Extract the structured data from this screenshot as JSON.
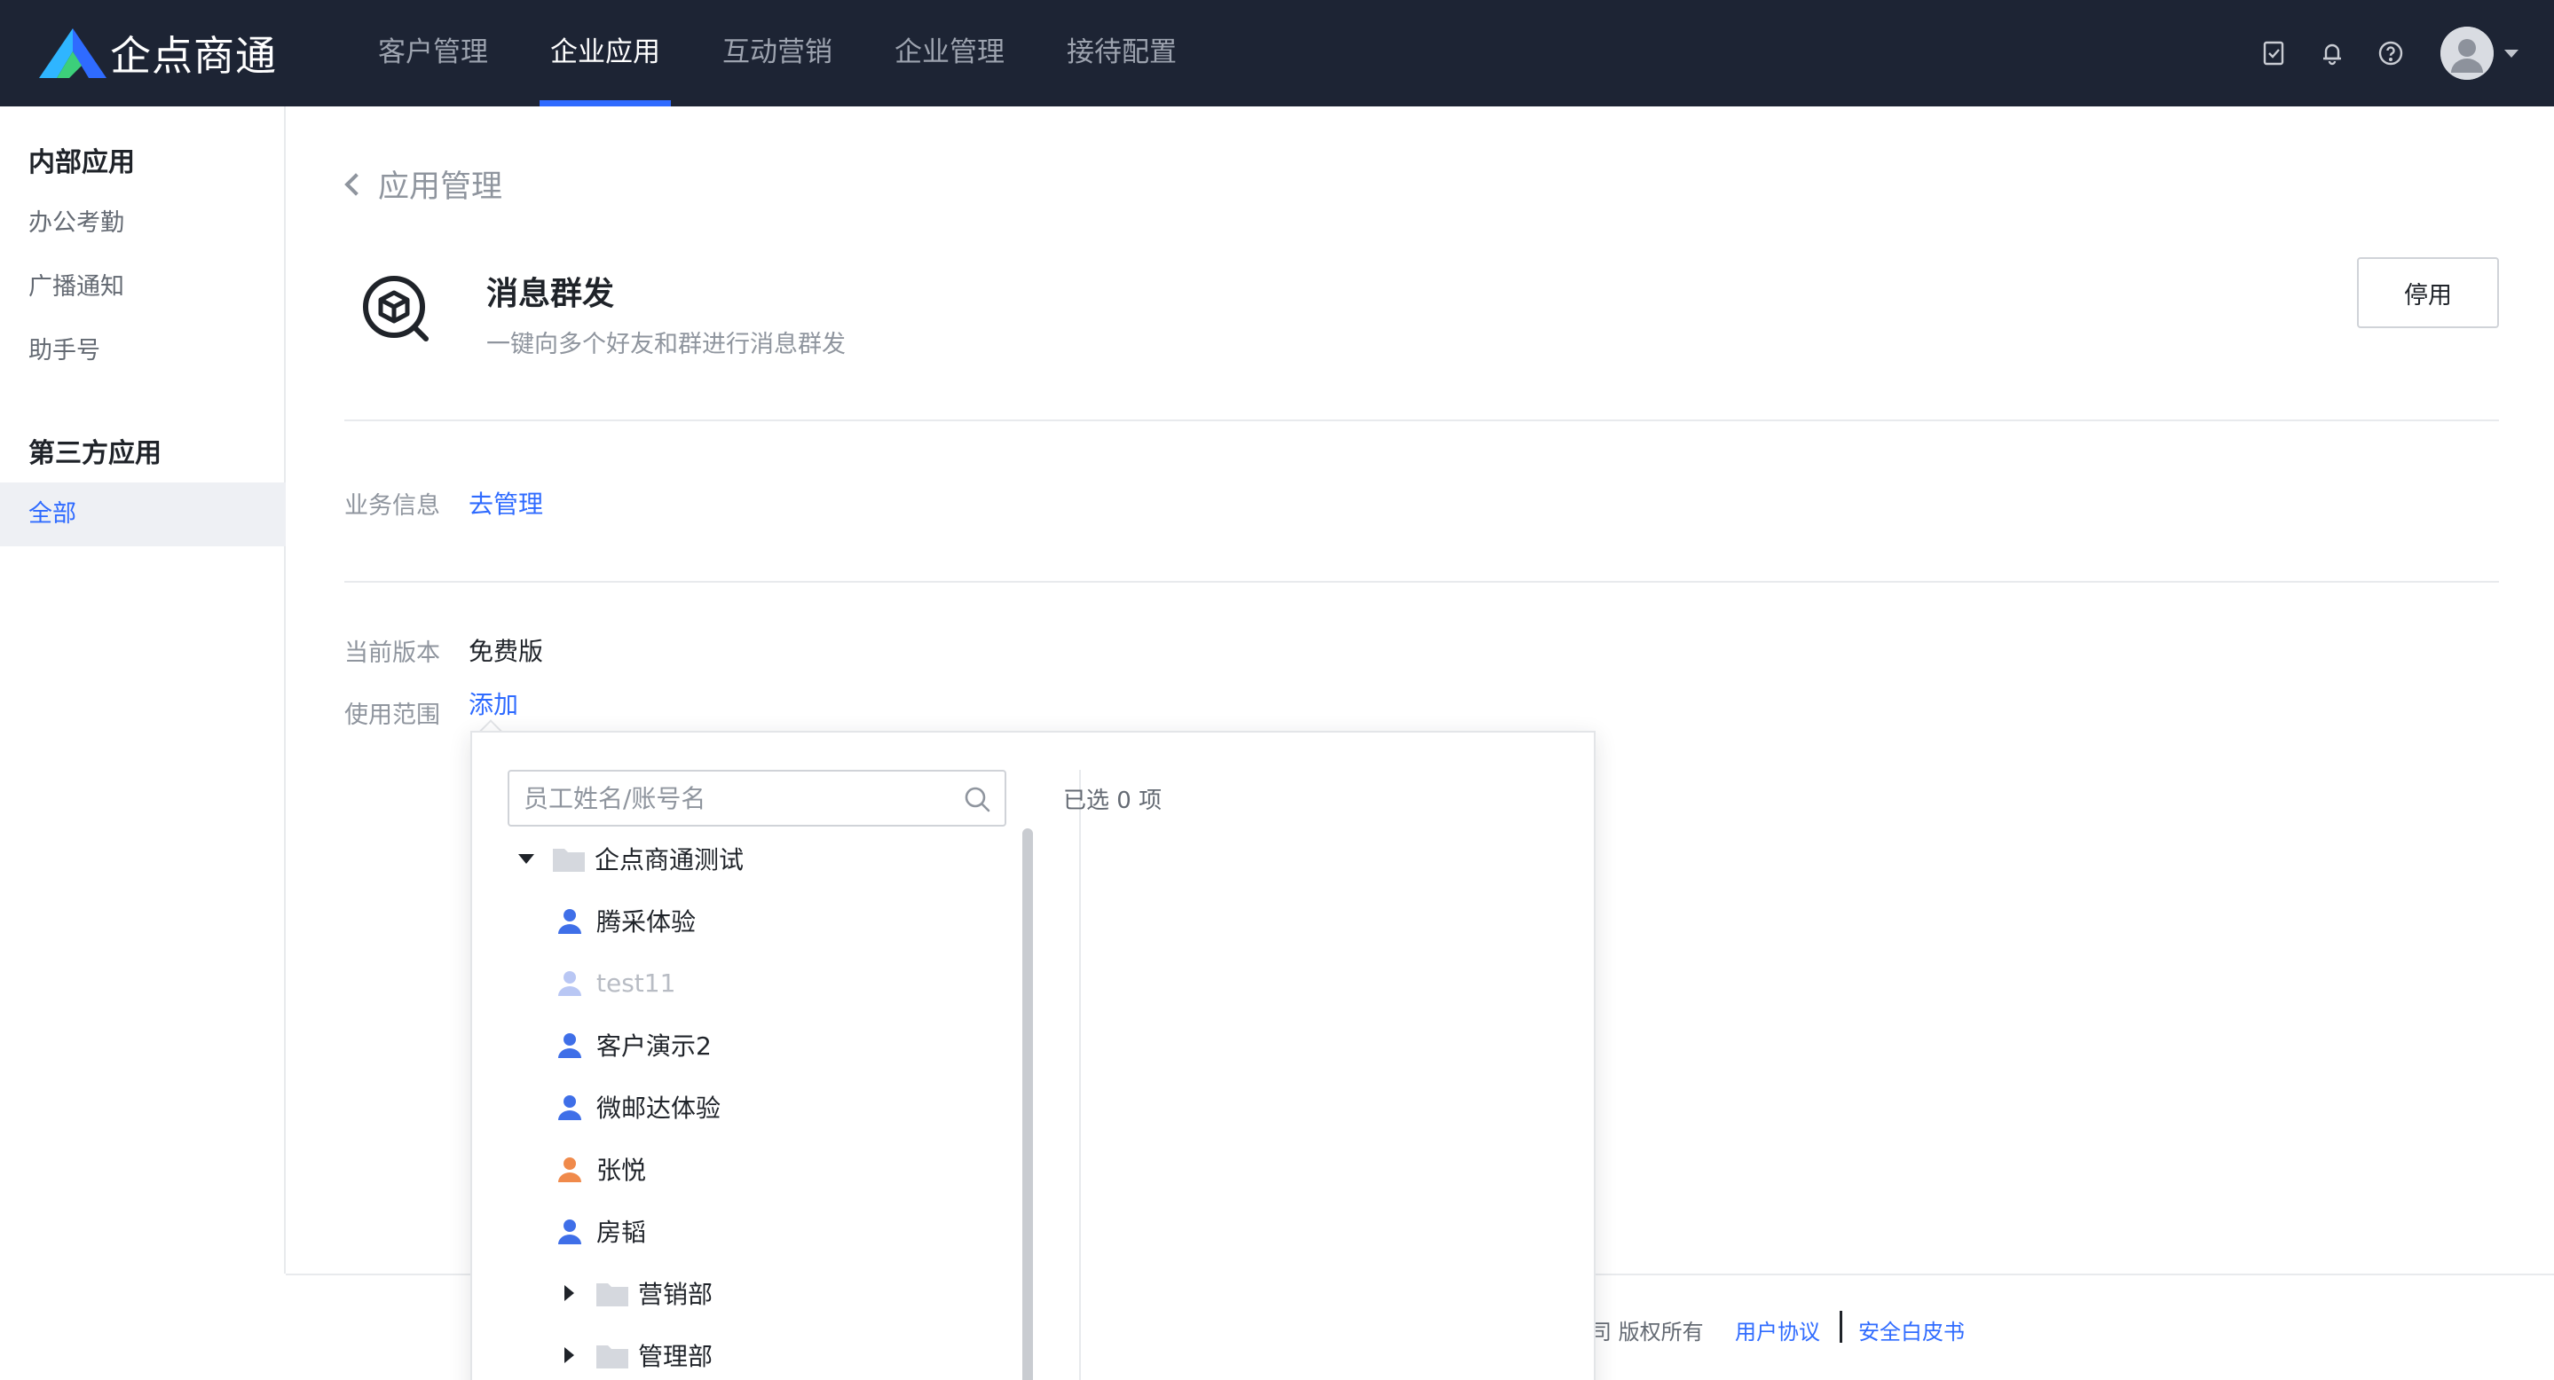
{
  "brand": {
    "name": "企点商通"
  },
  "nav": {
    "items": [
      {
        "label": "客户管理",
        "active": false
      },
      {
        "label": "企业应用",
        "active": true
      },
      {
        "label": "互动营销",
        "active": false
      },
      {
        "label": "企业管理",
        "active": false
      },
      {
        "label": "接待配置",
        "active": false
      }
    ],
    "icons": [
      "task-icon",
      "bell-icon",
      "help-icon",
      "avatar"
    ]
  },
  "sidebar": {
    "group1": "内部应用",
    "items1": [
      "办公考勤",
      "广播通知",
      "助手号"
    ],
    "group2": "第三方应用",
    "items2": [
      "全部"
    ]
  },
  "main": {
    "back_label": "应用管理",
    "app_title": "消息群发",
    "app_desc": "一键向多个好友和群进行消息群发",
    "stop_label": "停用",
    "biz_label": "业务信息",
    "biz_link": "去管理",
    "version_label": "当前版本",
    "version_value": "免费版",
    "scope_label": "使用范围",
    "scope_link": "添加"
  },
  "popover": {
    "search_placeholder": "员工姓名/账号名",
    "selected_text": "已选 0 项",
    "tree": [
      {
        "label": "企点商通测试",
        "type": "folder",
        "expanded": true
      },
      {
        "label": "腾采体验",
        "type": "person",
        "color": "#3f6fe8"
      },
      {
        "label": "test11",
        "type": "person",
        "color": "#b9c7f4",
        "disabled": true
      },
      {
        "label": "客户演示2",
        "type": "person",
        "color": "#3f6fe8"
      },
      {
        "label": "微邮达体验",
        "type": "person",
        "color": "#3f6fe8"
      },
      {
        "label": "张悦",
        "type": "person",
        "color": "#f08a4b"
      },
      {
        "label": "房韬",
        "type": "person",
        "color": "#3f6fe8"
      },
      {
        "label": "营销部",
        "type": "folder",
        "expanded": false
      },
      {
        "label": "管理部",
        "type": "folder",
        "expanded": false
      }
    ]
  },
  "footer": {
    "copyright_fragment": "司 版权所有",
    "user_agreement": "用户协议",
    "security_whitepaper": "安全白皮书"
  },
  "colors": {
    "accent": "#2f6bff",
    "topbar": "#1d2434",
    "person_blue": "#3f6fe8",
    "person_orange": "#f08a4b",
    "person_disabled": "#b9c7f4"
  }
}
